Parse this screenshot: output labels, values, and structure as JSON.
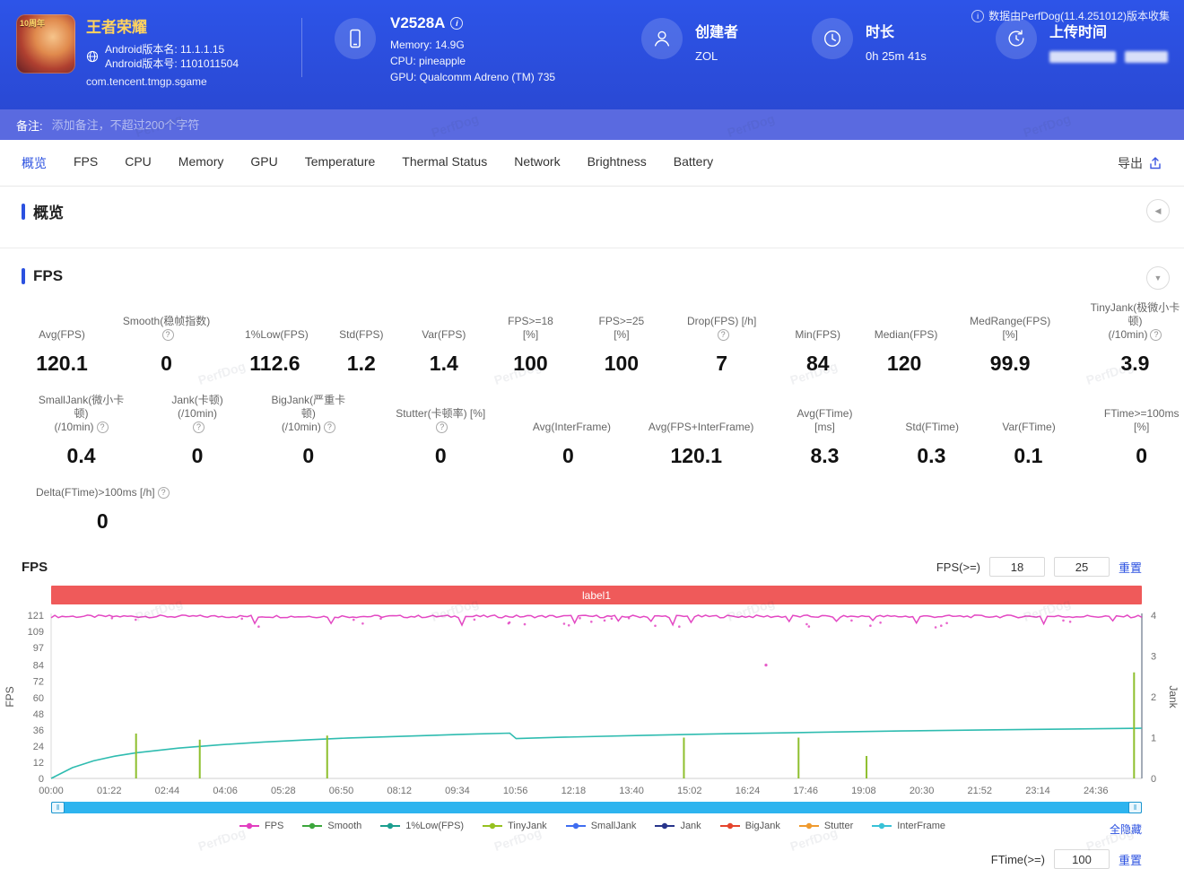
{
  "watermark": "PerfDog",
  "header": {
    "game": {
      "title": "王者荣耀",
      "badge": "10周年",
      "version_name": "Android版本名: 11.1.1.15",
      "version_code": "Android版本号: 1101011504",
      "package": "com.tencent.tmgp.sgame"
    },
    "device": {
      "name": "V2528A",
      "memory": "Memory: 14.9G",
      "cpu": "CPU: pineapple",
      "gpu": "GPU: Qualcomm Adreno (TM) 735"
    },
    "creator": {
      "label": "创建者",
      "value": "ZOL"
    },
    "duration": {
      "label": "时长",
      "value": "0h 25m 41s"
    },
    "upload": {
      "label": "上传时间",
      "masked": true
    },
    "collect_info": "数据由PerfDog(11.4.251012)版本收集"
  },
  "note_bar": {
    "label": "备注:",
    "placeholder": "添加备注，不超过200个字符"
  },
  "tabs": [
    "概览",
    "FPS",
    "CPU",
    "Memory",
    "GPU",
    "Temperature",
    "Thermal Status",
    "Network",
    "Brightness",
    "Battery"
  ],
  "active_tab": "概览",
  "export_label": "导出",
  "sections": {
    "overview_title": "概览",
    "fps_title": "FPS"
  },
  "fps_metrics": {
    "rows": [
      [
        {
          "label": "Avg(FPS)",
          "value": "120.1"
        },
        {
          "label": "Smooth(稳帧指数)",
          "value": "0",
          "help": true
        },
        {
          "label": "1%Low(FPS)",
          "value": "112.6"
        },
        {
          "label": "Std(FPS)",
          "value": "1.2"
        },
        {
          "label": "Var(FPS)",
          "value": "1.4"
        },
        {
          "label": "FPS>=18 [%]",
          "value": "100"
        },
        {
          "label": "FPS>=25 [%]",
          "value": "100"
        },
        {
          "label": "Drop(FPS) [/h]",
          "value": "7",
          "help": true
        },
        {
          "label": "Min(FPS)",
          "value": "84"
        },
        {
          "label": "Median(FPS)",
          "value": "120"
        },
        {
          "label": "MedRange(FPS)[%]",
          "value": "99.9"
        },
        {
          "label": "TinyJank(极微小卡顿)",
          "label2": "(/10min)",
          "value": "3.9",
          "help": true
        }
      ],
      [
        {
          "label": "SmallJank(微小卡顿)",
          "label2": "(/10min)",
          "value": "0.4",
          "help": true
        },
        {
          "label": "Jank(卡顿)",
          "label2": "(/10min)",
          "value": "0",
          "help": true
        },
        {
          "label": "BigJank(严重卡顿)",
          "label2": "(/10min)",
          "value": "0",
          "help": true
        },
        {
          "label": "Stutter(卡顿率) [%]",
          "value": "0",
          "help": true
        },
        {
          "label": "Avg(InterFrame)",
          "value": "0"
        },
        {
          "label": "Avg(FPS+InterFrame)",
          "value": "120.1"
        },
        {
          "label": "Avg(FTime) [ms]",
          "value": "8.3"
        },
        {
          "label": "Std(FTime)",
          "value": "0.3"
        },
        {
          "label": "Var(FTime)",
          "value": "0.1"
        },
        {
          "label": "FTime>=100ms [%]",
          "value": "0"
        }
      ],
      [
        {
          "label": "Delta(FTime)>100ms [/h]",
          "value": "0",
          "help": true
        }
      ]
    ]
  },
  "fps_chart": {
    "title": "FPS",
    "threshold_label": "FPS(>=)",
    "threshold1": "18",
    "threshold2": "25",
    "reset_label": "重置",
    "hide_all_label": "全隐藏",
    "footer": {
      "label": "FTime(>=)",
      "value": "100",
      "reset": "重置"
    },
    "legend": [
      {
        "name": "FPS",
        "color": "#e23ec0"
      },
      {
        "name": "Smooth",
        "color": "#3ca63c"
      },
      {
        "name": "1%Low(FPS)",
        "color": "#1b9e8f"
      },
      {
        "name": "TinyJank",
        "color": "#96c11f"
      },
      {
        "name": "SmallJank",
        "color": "#3f6df0"
      },
      {
        "name": "Jank",
        "color": "#27348b"
      },
      {
        "name": "BigJank",
        "color": "#e5442c"
      },
      {
        "name": "Stutter",
        "color": "#ef9a2e"
      },
      {
        "name": "InterFrame",
        "color": "#39c2d7"
      }
    ]
  },
  "chart_data": {
    "type": "line",
    "title": "label1",
    "duration_seconds": 1541,
    "x_ticks": [
      "00:00",
      "01:22",
      "02:44",
      "04:06",
      "05:28",
      "06:50",
      "08:12",
      "09:34",
      "10:56",
      "12:18",
      "13:40",
      "15:02",
      "16:24",
      "17:46",
      "19:08",
      "20:30",
      "21:52",
      "23:14",
      "24:36"
    ],
    "x_tick_interval_seconds": 82,
    "y_left": {
      "label": "FPS",
      "ticks": [
        0,
        12,
        24,
        36,
        48,
        60,
        72,
        84,
        97,
        109,
        121
      ],
      "range": [
        0,
        121
      ]
    },
    "y_right": {
      "label": "Jank",
      "ticks": [
        0,
        1,
        2,
        3,
        4
      ],
      "range": [
        0,
        4
      ]
    },
    "series": [
      {
        "name": "FPS",
        "color": "#e23ec0",
        "axis": "left",
        "style": "noisy-flat",
        "baseline": 120.1,
        "min": 84
      },
      {
        "name": "InterFrame",
        "color": "#2fbcb0",
        "axis": "left",
        "style": "curve",
        "points": [
          [
            0,
            0
          ],
          [
            0.5,
            8
          ],
          [
            1,
            13
          ],
          [
            1.5,
            16.5
          ],
          [
            2,
            19
          ],
          [
            3,
            22.5
          ],
          [
            4,
            25
          ],
          [
            5,
            27
          ],
          [
            6,
            28.5
          ],
          [
            7,
            30
          ],
          [
            8,
            31
          ],
          [
            9,
            32
          ],
          [
            10,
            33
          ],
          [
            10.8,
            33.6
          ],
          [
            10.95,
            29.5
          ],
          [
            12,
            30.5
          ],
          [
            14,
            32
          ],
          [
            16,
            33.2
          ],
          [
            18,
            34.2
          ],
          [
            20,
            35.2
          ],
          [
            22,
            36
          ],
          [
            24,
            36.6
          ],
          [
            25.68,
            37.2
          ]
        ]
      },
      {
        "name": "TinyJank",
        "color": "#8ebf2e",
        "axis": "right",
        "style": "spikes",
        "events": [
          [
            2.0,
            1.1
          ],
          [
            3.5,
            0.95
          ],
          [
            6.5,
            1.05
          ],
          [
            14.9,
            1.0
          ],
          [
            17.6,
            1.0
          ],
          [
            19.2,
            0.55
          ],
          [
            25.5,
            2.6
          ]
        ]
      }
    ]
  }
}
